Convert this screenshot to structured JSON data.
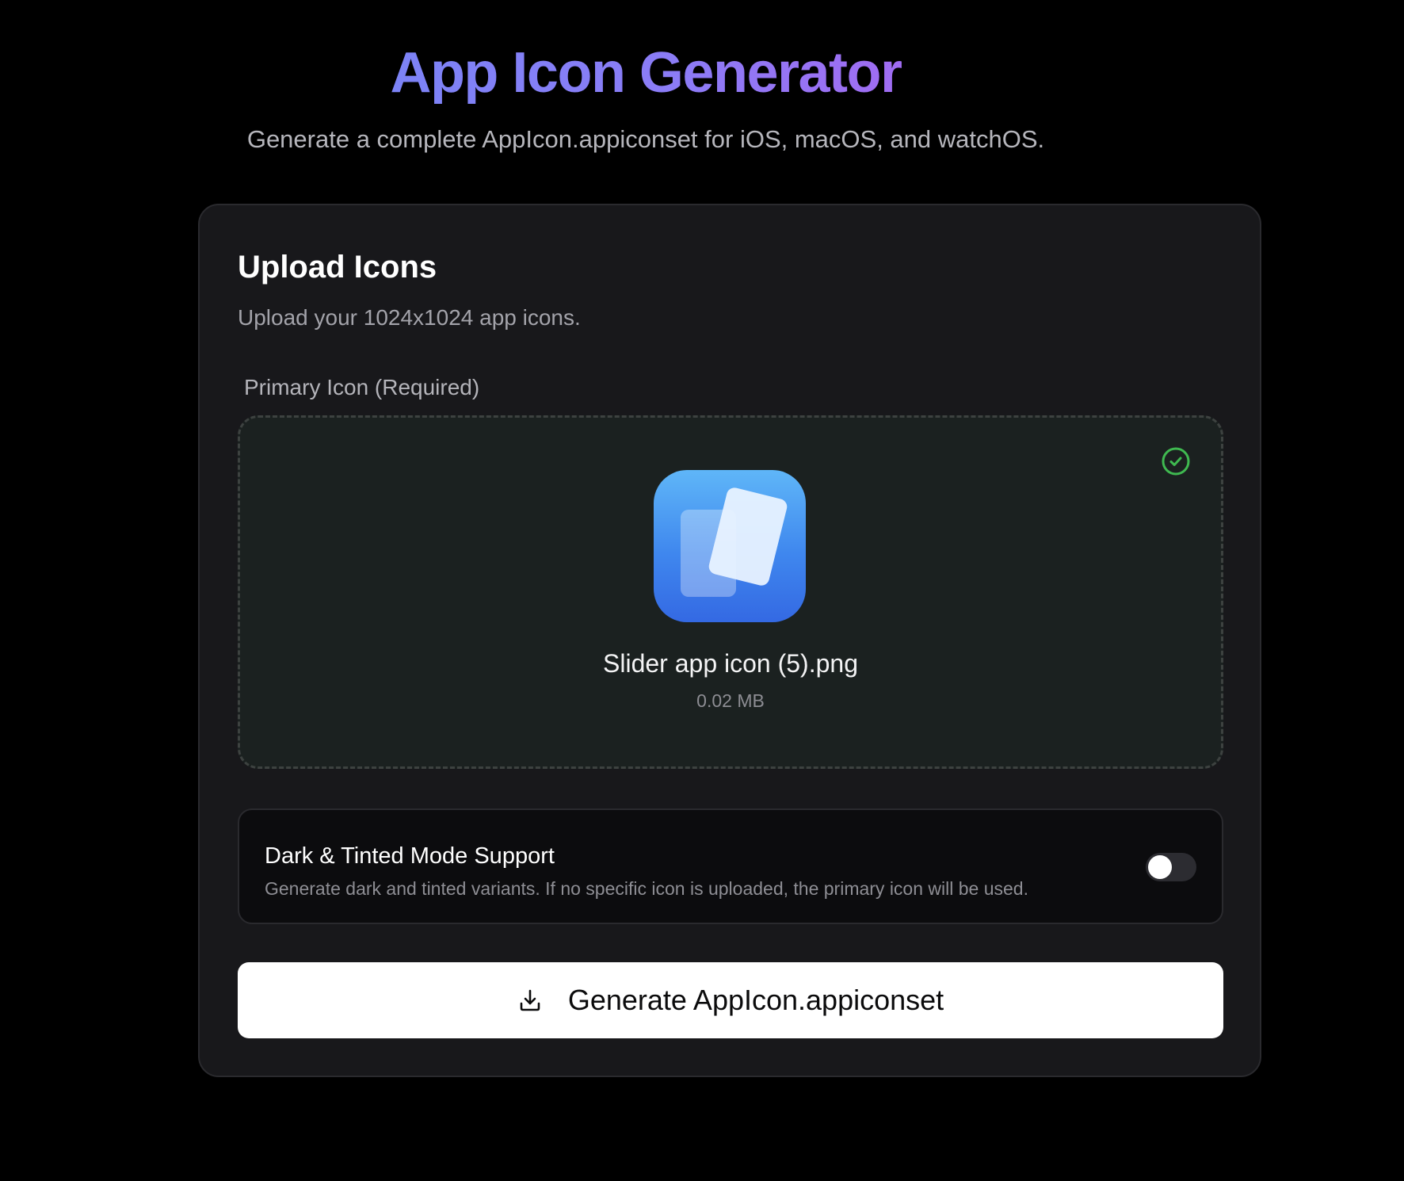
{
  "header": {
    "title": "App Icon Generator",
    "subtitle": "Generate a complete AppIcon.appiconset for iOS, macOS, and watchOS."
  },
  "upload_card": {
    "title": "Upload Icons",
    "description": "Upload your 1024x1024 app icons.",
    "primary_field": {
      "label": "Primary Icon (Required)",
      "status_icon": "check-circle-icon",
      "status_color": "#3fb950",
      "file_name": "Slider app icon (5).png",
      "file_size": "0.02 MB"
    },
    "dark_tinted_option": {
      "title": "Dark & Tinted Mode Support",
      "description": "Generate dark and tinted variants. If no specific icon is uploaded, the primary icon will be used.",
      "enabled": false
    },
    "generate_button": {
      "label": "Generate AppIcon.appiconset",
      "icon": "download-icon"
    }
  },
  "colors": {
    "title_gradient_start": "#7c83f6",
    "title_gradient_end": "#a06cf2",
    "app_icon_gradient_top": "#5fb6f8",
    "app_icon_gradient_bottom": "#3469e3"
  }
}
